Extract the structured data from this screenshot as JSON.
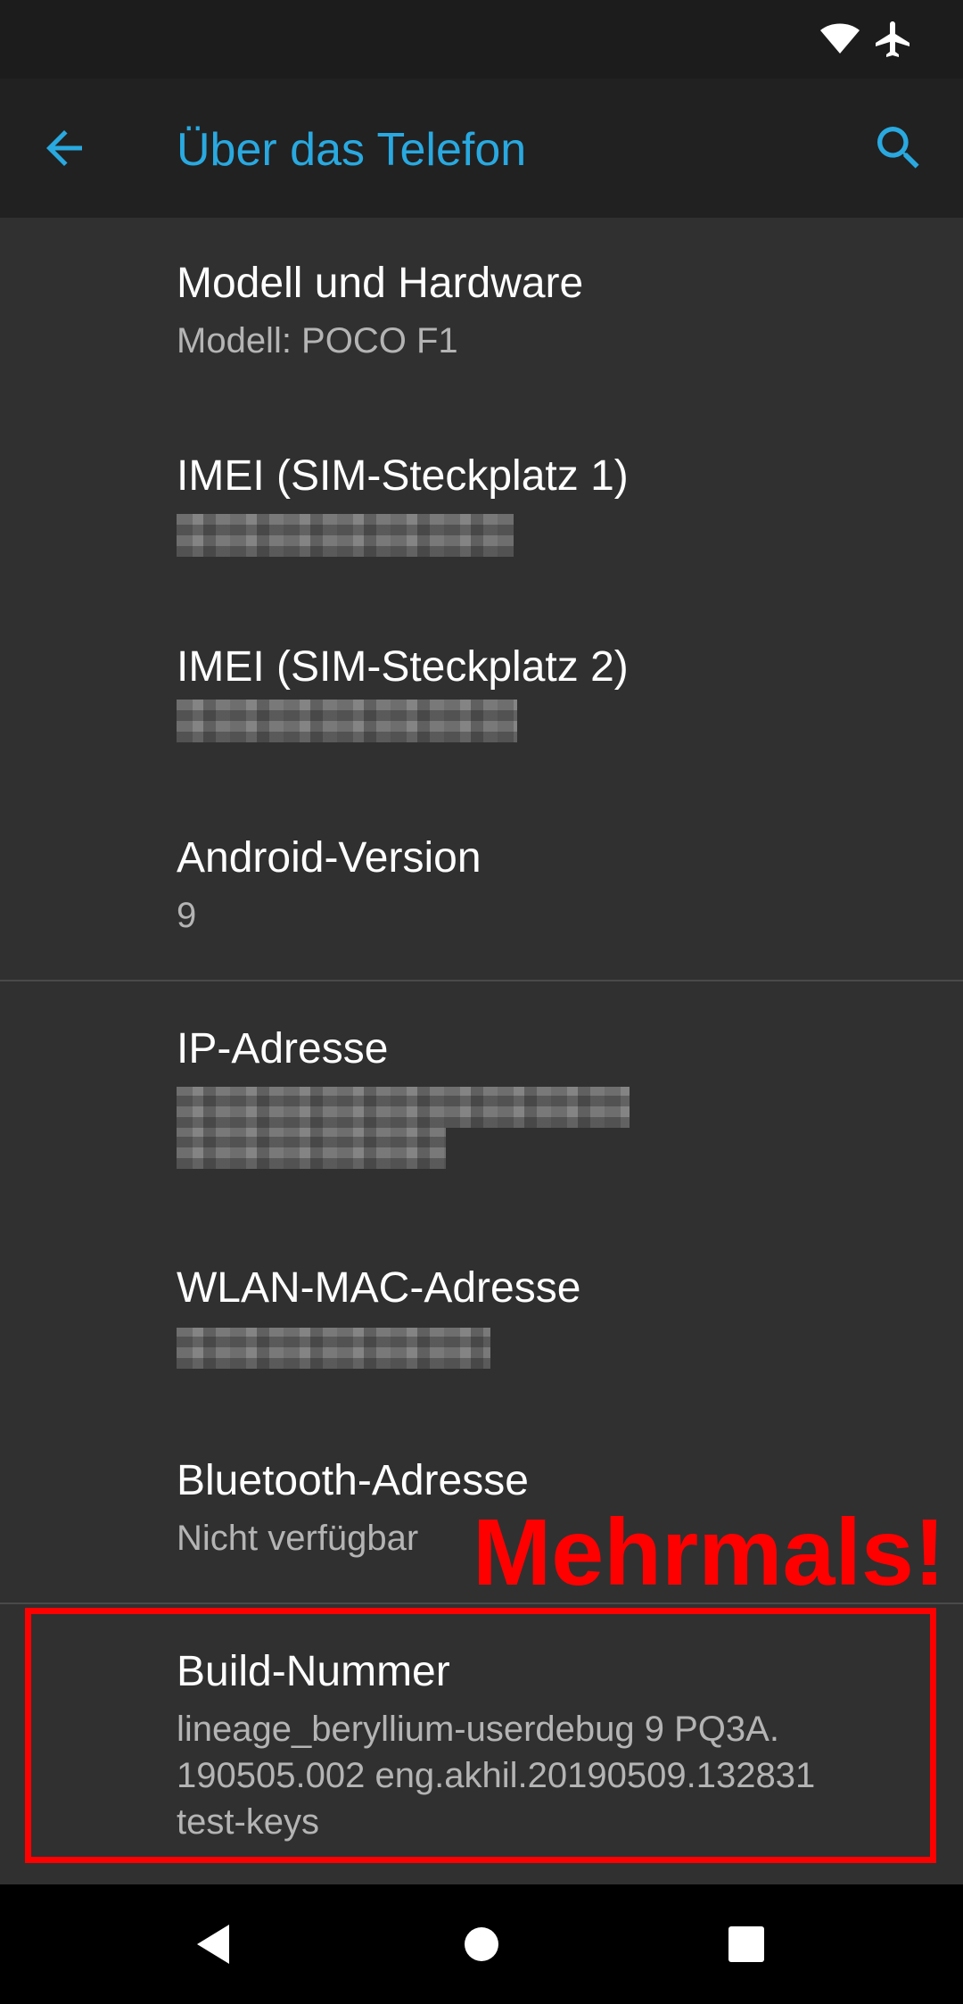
{
  "toolbar": {
    "title": "Über das Telefon"
  },
  "colors": {
    "accent": "#29a9e0",
    "annotation": "#ff0000"
  },
  "icons": {
    "status": [
      "wifi-icon",
      "airplane-mode-icon"
    ],
    "toolbar": [
      "back-arrow-icon",
      "search-icon"
    ],
    "navigation": [
      "nav-back-icon",
      "nav-home-icon",
      "nav-recents-icon"
    ]
  },
  "items": [
    {
      "title": "Modell und Hardware",
      "summary": "Modell: POCO F1"
    },
    {
      "title": "IMEI (SIM-Steckplatz 1)"
    },
    {
      "title": "IMEI (SIM-Steckplatz 2)"
    },
    {
      "title": "Android-Version",
      "summary": "9"
    },
    {
      "title": "IP-Adresse"
    },
    {
      "title": "WLAN-MAC-Adresse"
    },
    {
      "title": "Bluetooth-Adresse",
      "summary": "Nicht verfügbar"
    },
    {
      "title": "Build-Nummer",
      "summary_lines": [
        "lineage_beryllium-userdebug 9 PQ3A.",
        "190505.002 eng.akhil.20190509.132831",
        "test-keys"
      ]
    }
  ],
  "annotation": {
    "text": "Mehrmals!"
  }
}
